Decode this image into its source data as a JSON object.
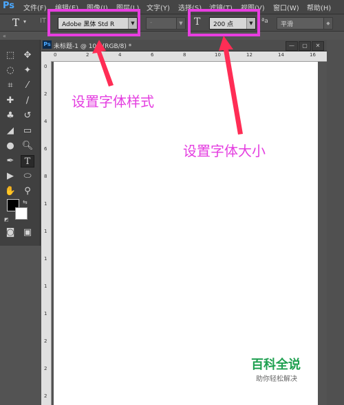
{
  "app": {
    "logo": "Ps"
  },
  "menu": [
    "文件(F)",
    "编辑(E)",
    "图像(I)",
    "图层(L)",
    "文字(Y)",
    "选择(S)",
    "滤镜(T)",
    "视图(V)",
    "窗口(W)",
    "帮助(H)"
  ],
  "options": {
    "tool_glyph": "T",
    "orient_glyph": "IT",
    "font_family": "Adobe 黑体 Std R",
    "font_style": "-",
    "size_glyph": "T",
    "font_size": "200 点",
    "aa_glyph": "ªa",
    "aa_mode": "平滑"
  },
  "document": {
    "title": "未标题-1 @ 10...(RGB/8) *",
    "tab_logo": "Ps"
  },
  "ruler": {
    "h": [
      "0",
      "2",
      "4",
      "6",
      "8",
      "10",
      "12",
      "14",
      "16"
    ],
    "v": [
      "0",
      "2",
      "4",
      "6",
      "8",
      "1",
      "1",
      "1",
      "1",
      "1",
      "2",
      "2",
      "2"
    ]
  },
  "annotations": {
    "font_style_label": "设置字体样式",
    "font_size_label": "设置字体大小"
  },
  "watermark": {
    "title": "百科全说",
    "subtitle": "助你轻松解决"
  },
  "colors": {
    "highlight": "#e83ee0",
    "annotation_text": "#e43ee0",
    "watermark_green": "#1ea050"
  }
}
